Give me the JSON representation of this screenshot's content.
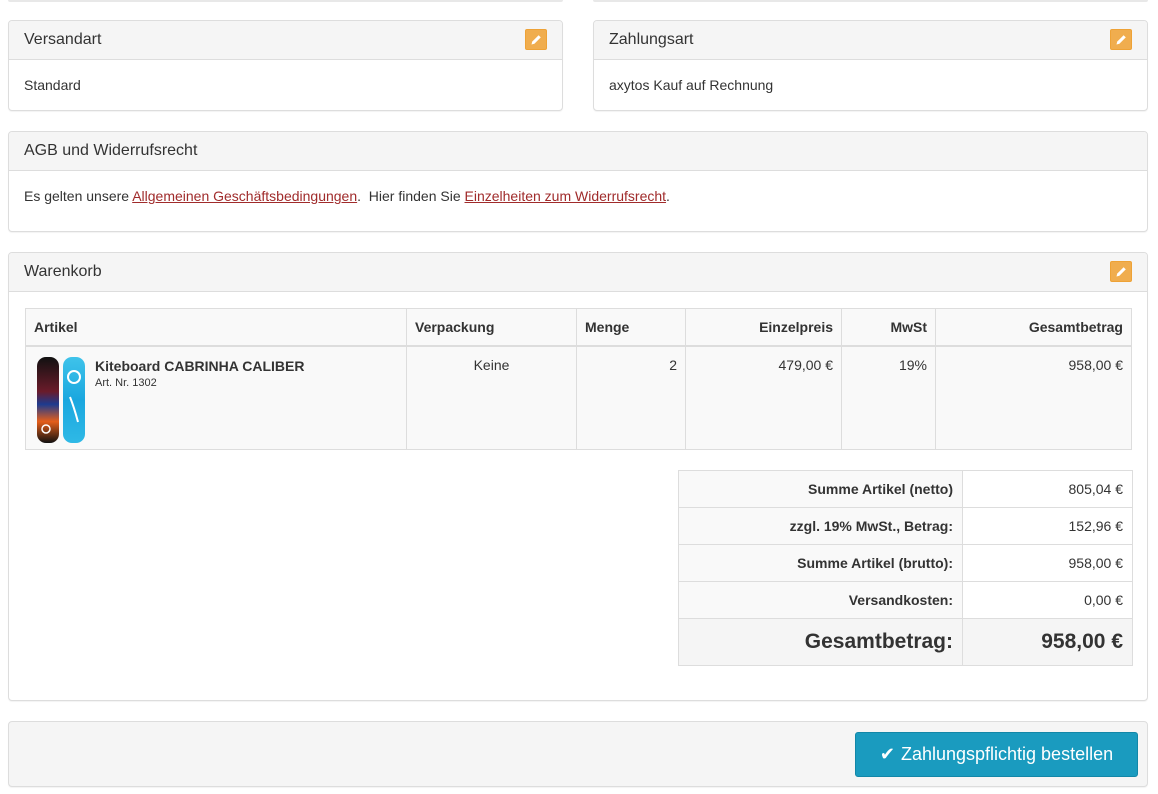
{
  "versand": {
    "title": "Versandart",
    "value": "Standard"
  },
  "zahlung": {
    "title": "Zahlungsart",
    "value": "axytos Kauf auf Rechnung"
  },
  "agb": {
    "title": "AGB und Widerrufsrecht",
    "text1": "Es gelten unsere ",
    "link1": "Allgemeinen Geschäftsbedingungen",
    "text2": ".  Hier finden Sie ",
    "link2": "Einzelheiten zum Widerrufsrecht",
    "text3": "."
  },
  "cart": {
    "title": "Warenkorb",
    "columns": [
      "Artikel",
      "Verpackung",
      "Menge",
      "Einzelpreis",
      "MwSt",
      "Gesamtbetrag"
    ],
    "items": [
      {
        "name": "Kiteboard CABRINHA CALIBER",
        "artnr": "Art. Nr. 1302",
        "verpackung": "Keine",
        "menge": "2",
        "einzelpreis": "479,00 €",
        "mwst": "19%",
        "gesamt": "958,00 €"
      }
    ],
    "totals": [
      {
        "label": "Summe Artikel (netto)",
        "value": "805,04 €"
      },
      {
        "label": "zzgl. 19% MwSt., Betrag:",
        "value": "152,96 €"
      },
      {
        "label": "Summe Artikel (brutto):",
        "value": "958,00 €"
      },
      {
        "label": "Versandkosten:",
        "value": "0,00 €"
      }
    ],
    "grand_total": {
      "label": "Gesamtbetrag:",
      "value": "958,00 €"
    }
  },
  "order_button": {
    "check_glyph": "✔",
    "label": "Zahlungspflichtig bestellen"
  },
  "icons": {
    "edit": "pencil-icon",
    "check": "check-icon"
  },
  "colors": {
    "edit_button": "#f0ad4e",
    "order_button": "#1a9bbf",
    "link": "#a02b2b"
  }
}
